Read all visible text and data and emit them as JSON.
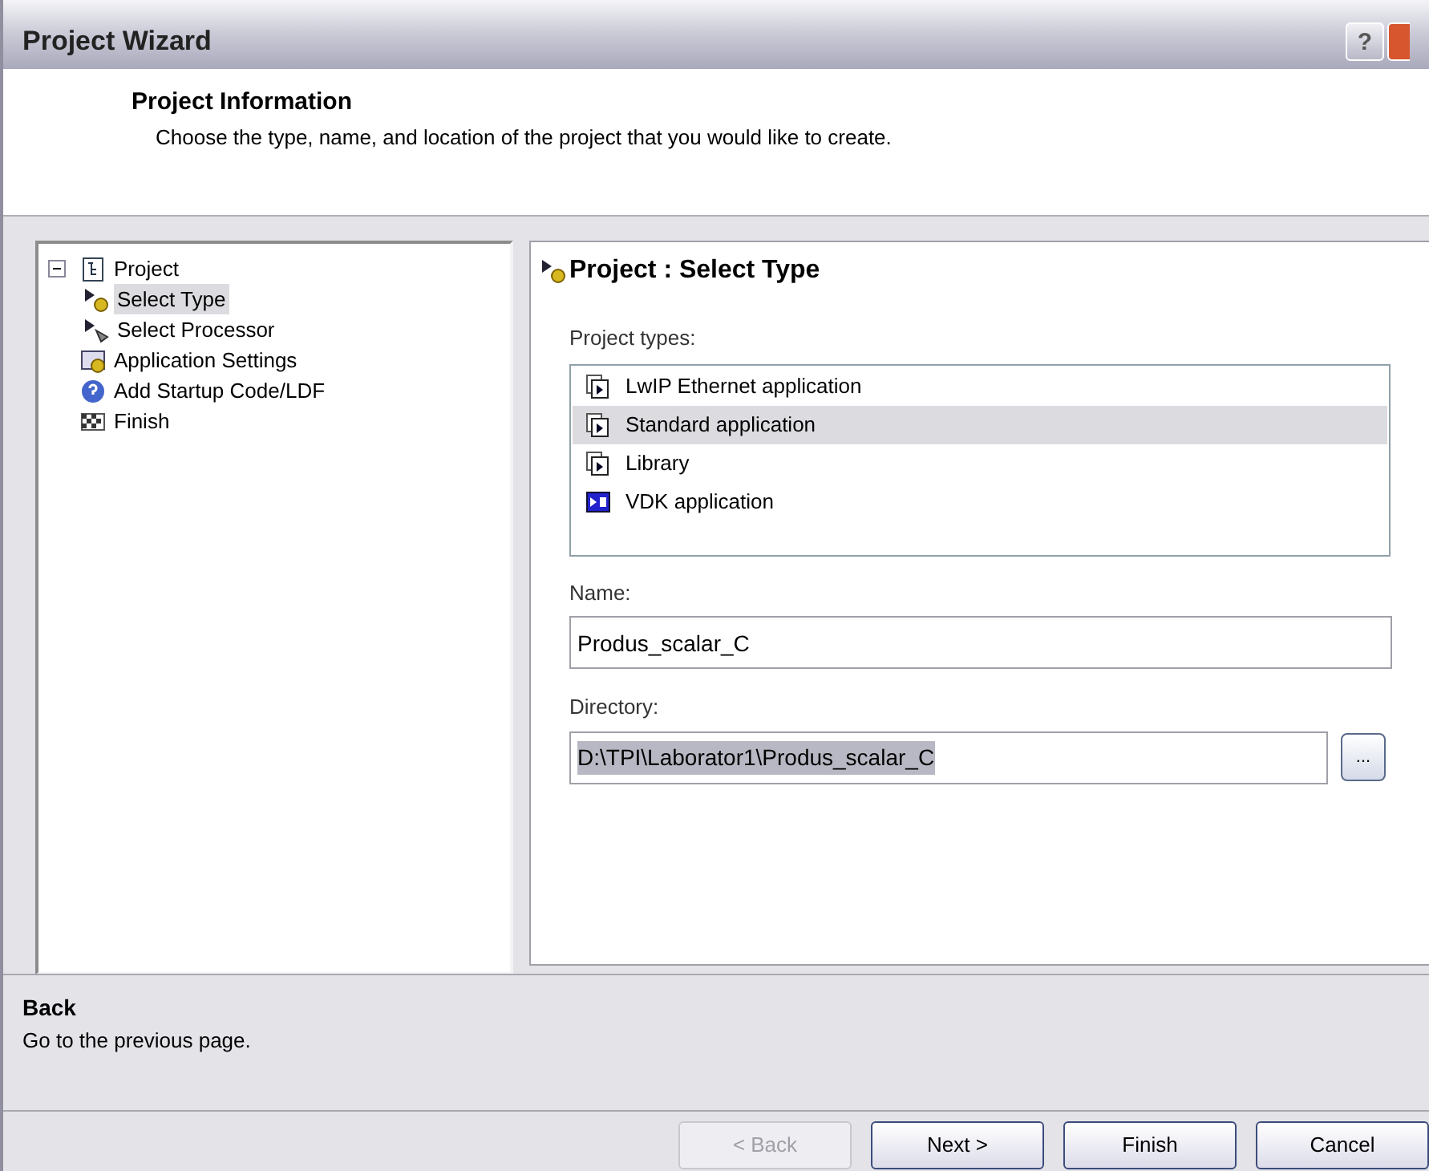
{
  "window": {
    "title": "Project Wizard",
    "help_button": "?"
  },
  "header": {
    "title": "Project Information",
    "subtitle": "Choose the type, name, and location of the project that you would like to create."
  },
  "tree": [
    {
      "label": "Project",
      "kind": "project",
      "selected": false,
      "expanded": true,
      "children": [
        {
          "label": "Select Type",
          "kind": "type",
          "selected": true
        },
        {
          "label": "Select Processor",
          "kind": "processor",
          "selected": false
        }
      ]
    },
    {
      "label": "Application Settings",
      "kind": "settings",
      "selected": false
    },
    {
      "label": "Add Startup Code/LDF",
      "kind": "help",
      "selected": false
    },
    {
      "label": "Finish",
      "kind": "finish",
      "selected": false
    }
  ],
  "page": {
    "title": "Project : Select Type",
    "types_label": "Project types:",
    "project_types": [
      {
        "label": "LwIP Ethernet application",
        "kind": "app",
        "selected": false
      },
      {
        "label": "Standard application",
        "kind": "app",
        "selected": true
      },
      {
        "label": "Library",
        "kind": "app",
        "selected": false
      },
      {
        "label": "VDK application",
        "kind": "vdk",
        "selected": false
      }
    ],
    "name_label": "Name:",
    "name": "Produs_scalar_C",
    "directory_label": "Directory:",
    "directory": "D:\\TPI\\Laborator1\\Produs_scalar_C",
    "directory_selected": true,
    "browse": "..."
  },
  "help": {
    "title": "Back",
    "text": "Go to the previous page."
  },
  "buttons": [
    {
      "label": "< Back",
      "disabled": true
    },
    {
      "label": "Next >",
      "disabled": false
    },
    {
      "label": "Finish",
      "disabled": false
    },
    {
      "label": "Cancel",
      "disabled": false
    }
  ]
}
